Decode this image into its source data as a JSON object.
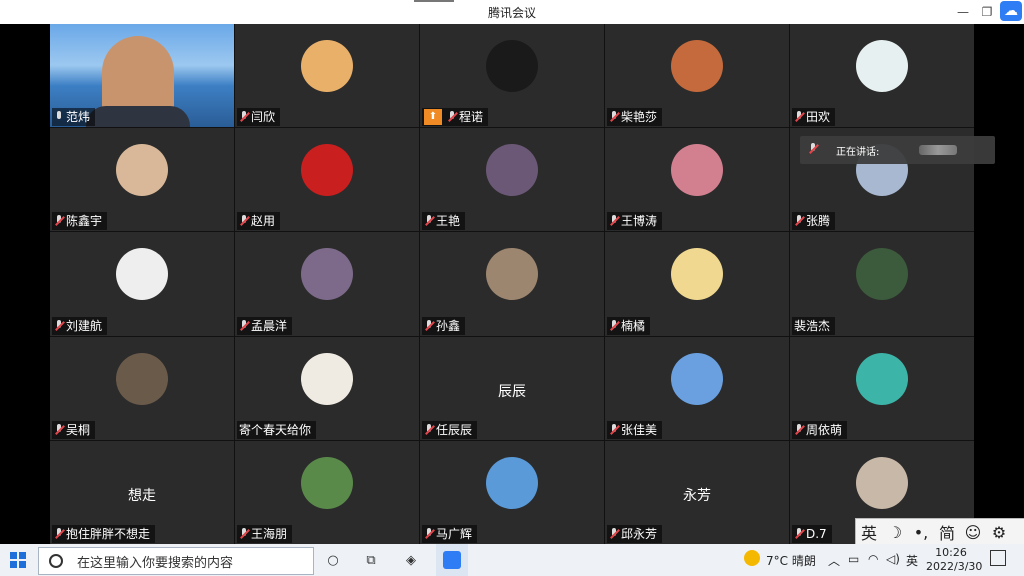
{
  "window": {
    "title": "腾讯会议"
  },
  "speaking": {
    "label": "正在讲话:"
  },
  "participants": [
    {
      "name": "范炜",
      "kind": "video",
      "mic": "on"
    },
    {
      "name": "闫欣",
      "kind": "avatar",
      "color": "#e9b06a"
    },
    {
      "name": "程诺",
      "kind": "avatar",
      "color": "#1a1a1a",
      "sharing": true
    },
    {
      "name": "柴艳莎",
      "kind": "avatar",
      "color": "#c46a3c"
    },
    {
      "name": "田欢",
      "kind": "avatar",
      "color": "#e6f0f0"
    },
    {
      "name": "陈鑫宇",
      "kind": "avatar",
      "color": "#d8b898"
    },
    {
      "name": "赵用",
      "kind": "avatar",
      "color": "#c91f1f"
    },
    {
      "name": "王艳",
      "kind": "avatar",
      "color": "#6b5876"
    },
    {
      "name": "王博涛",
      "kind": "avatar",
      "color": "#d28090"
    },
    {
      "name": "张腾",
      "kind": "avatar",
      "color": "#a8b8d0"
    },
    {
      "name": "刘建航",
      "kind": "avatar",
      "color": "#eeeeee"
    },
    {
      "name": "孟晨洋",
      "kind": "avatar",
      "color": "#7d6a8a"
    },
    {
      "name": "孙鑫",
      "kind": "avatar",
      "color": "#9c8670"
    },
    {
      "name": "楠橘",
      "kind": "avatar",
      "color": "#f0d890"
    },
    {
      "name": "裴浩杰",
      "kind": "avatar",
      "color": "#3c5a3c",
      "mic": "none"
    },
    {
      "name": "吴桐",
      "kind": "avatar",
      "color": "#6a5a4a"
    },
    {
      "name": "寄个春天给你",
      "kind": "avatar",
      "color": "#efeae2",
      "mic": "none"
    },
    {
      "name": "任辰辰",
      "kind": "text",
      "display": "辰辰"
    },
    {
      "name": "张佳美",
      "kind": "avatar",
      "color": "#6aa0e0"
    },
    {
      "name": "周依萌",
      "kind": "avatar",
      "color": "#3cb4a8"
    },
    {
      "name": "抱住胖胖不想走",
      "kind": "text",
      "display": "想走"
    },
    {
      "name": "王海朋",
      "kind": "avatar",
      "color": "#5a8a4a"
    },
    {
      "name": "马广辉",
      "kind": "avatar",
      "color": "#5a9ad8"
    },
    {
      "name": "邱永芳",
      "kind": "text",
      "display": "永芳"
    },
    {
      "name": "D.7",
      "kind": "avatar",
      "color": "#c8b8a8"
    }
  ],
  "ime": {
    "lang": "英",
    "moon": "☽",
    "punct": "•,",
    "mode": "简",
    "emoji": "☺",
    "gear": "⚙"
  },
  "taskbar": {
    "search_placeholder": "在这里输入你要搜索的内容",
    "weather": "7°C 晴朗",
    "ime_lang": "英",
    "time": "10:26",
    "date": "2022/3/30"
  }
}
